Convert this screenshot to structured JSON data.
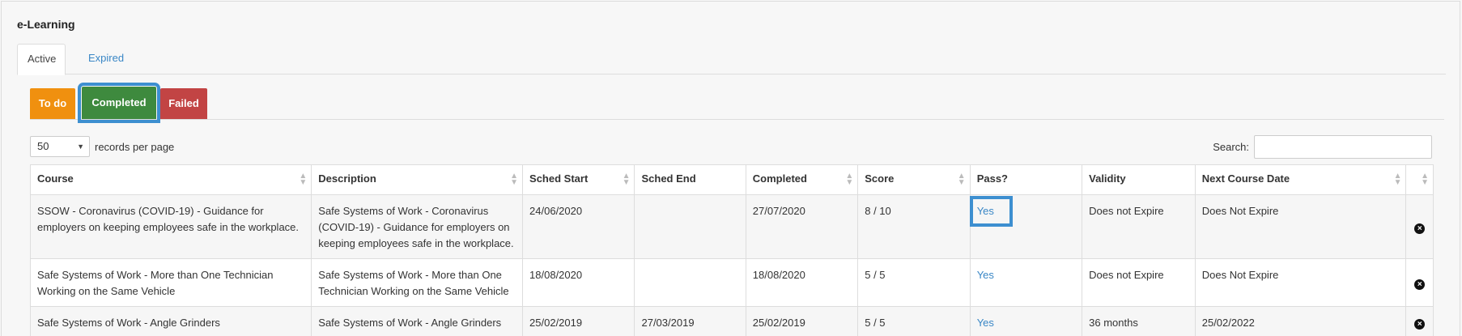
{
  "panel": {
    "title": "e-Learning"
  },
  "top_tabs": [
    {
      "label": "Active"
    },
    {
      "label": "Expired"
    }
  ],
  "status_tabs": {
    "todo": "To do",
    "completed": "Completed",
    "failed": "Failed"
  },
  "length": {
    "value": "50",
    "suffix": "records per page"
  },
  "search": {
    "label": "Search:",
    "placeholder": ""
  },
  "columns": [
    "Course",
    "Description",
    "Sched Start",
    "Sched End",
    "Completed",
    "Score",
    "Pass?",
    "Validity",
    "Next Course Date",
    ""
  ],
  "rows": [
    {
      "course": "SSOW - Coronavirus (COVID-19) - Guidance for employers on keeping employees safe in the workplace.",
      "description": "Safe Systems of Work - Coronavirus (COVID-19) - Guidance for employers on keeping employees safe in the workplace.",
      "sched_start": "24/06/2020",
      "sched_end": "",
      "completed": "27/07/2020",
      "score": "8 / 10",
      "pass": "Yes",
      "validity": "Does not Expire",
      "next_course_date": "Does Not Expire"
    },
    {
      "course": "Safe Systems of Work - More than One Technician Working on the Same Vehicle",
      "description": "Safe Systems of Work - More than One Technician Working on the Same Vehicle",
      "sched_start": "18/08/2020",
      "sched_end": "",
      "completed": "18/08/2020",
      "score": "5 / 5",
      "pass": "Yes",
      "validity": "Does not Expire",
      "next_course_date": "Does Not Expire"
    },
    {
      "course": "Safe Systems of Work - Angle Grinders",
      "description": "Safe Systems of Work - Angle Grinders",
      "sched_start": "25/02/2019",
      "sched_end": "27/03/2019",
      "completed": "25/02/2019",
      "score": "5 / 5",
      "pass": "Yes",
      "validity": "36 months",
      "next_course_date": "25/02/2022"
    }
  ],
  "icons": {
    "sort": "sort-icon",
    "remove": "remove-circle-icon",
    "dropdown": "caret-down-icon"
  },
  "colors": {
    "todo": "#f0900f",
    "completed": "#3e8a3e",
    "failed": "#c24444",
    "link": "#3a87c6",
    "highlight": "#3d8fd0"
  }
}
